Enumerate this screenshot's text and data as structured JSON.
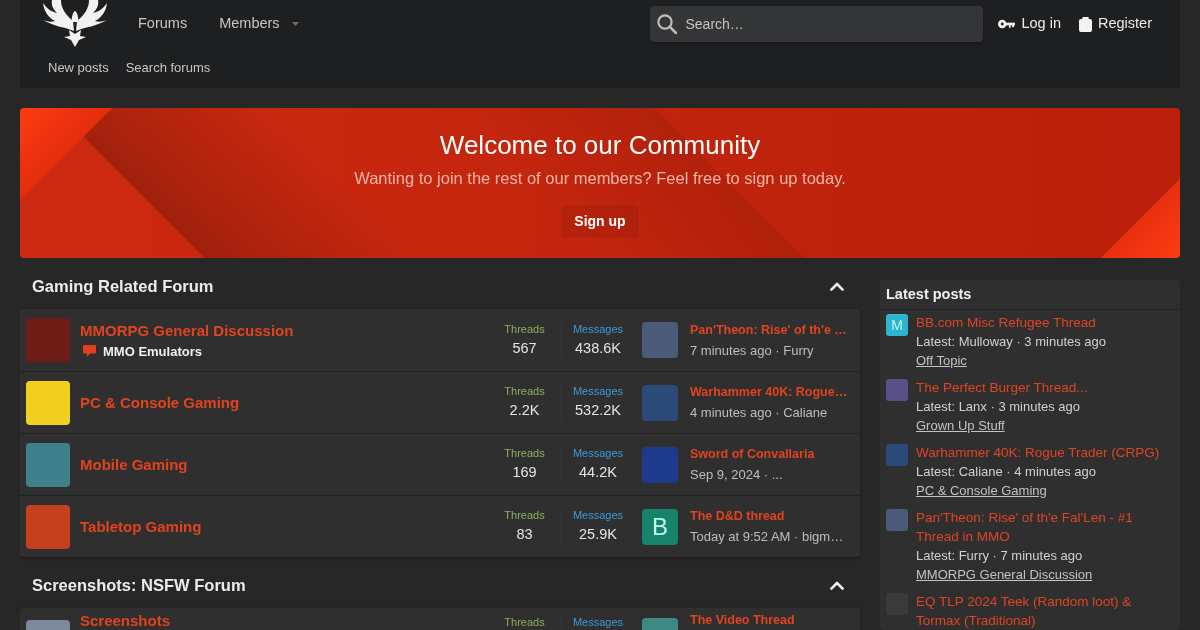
{
  "header": {
    "nav": [
      {
        "label": "Forums",
        "kind": "link"
      },
      {
        "label": "Members",
        "kind": "dropdown"
      }
    ],
    "search": {
      "placeholder": "Search…"
    },
    "account": [
      {
        "label": "Log in",
        "kind": "login"
      },
      {
        "label": "Register",
        "kind": "register"
      }
    ],
    "subnav": [
      "New posts",
      "Search forums"
    ]
  },
  "banner": {
    "title": "Welcome to our Community",
    "subtitle": "Wanting to join the rest of our members? Feel free to sign up today.",
    "button": "Sign up"
  },
  "categories": [
    {
      "title": "Gaming Related Forum",
      "expanded": true,
      "forums": [
        {
          "title": "MMORPG General Discussion",
          "icon": {
            "color": "#6e1d16"
          },
          "subforums": [
            "MMO Emulators"
          ],
          "stats": [
            {
              "kind": "threads",
              "label": "Threads",
              "value": "567"
            },
            {
              "kind": "messages",
              "label": "Messages",
              "value": "438.6K"
            }
          ],
          "last_post": {
            "title": "Pan'Theon: Rise' of th'e …",
            "meta": "7 minutes ago · Furry",
            "avatar": {
              "kind": "image",
              "color": "#4a5a78"
            }
          }
        },
        {
          "title": "PC & Console Gaming",
          "icon": {
            "color": "#f0cf1e"
          },
          "stats": [
            {
              "kind": "threads",
              "label": "Threads",
              "value": "2.2K"
            },
            {
              "kind": "messages",
              "label": "Messages",
              "value": "532.2K"
            }
          ],
          "last_post": {
            "title": "Warhammer 40K: Rogue…",
            "meta": "4 minutes ago · Caliane",
            "avatar": {
              "kind": "image",
              "color": "#2c4a78"
            }
          }
        },
        {
          "title": "Mobile Gaming",
          "icon": {
            "color": "#3f7f8c"
          },
          "stats": [
            {
              "kind": "threads",
              "label": "Threads",
              "value": "169"
            },
            {
              "kind": "messages",
              "label": "Messages",
              "value": "44.2K"
            }
          ],
          "last_post": {
            "title": "Sword of Convallaria",
            "meta": "Sep 9, 2024 · ...",
            "avatar": {
              "kind": "image",
              "color": "#1e3a8c"
            }
          }
        },
        {
          "title": "Tabletop Gaming",
          "icon": {
            "color": "#c4401c"
          },
          "stats": [
            {
              "kind": "threads",
              "label": "Threads",
              "value": "83"
            },
            {
              "kind": "messages",
              "label": "Messages",
              "value": "25.9K"
            }
          ],
          "last_post": {
            "title": "The D&D thread",
            "meta": "Today at 9:52 AM · bigm…",
            "avatar": {
              "kind": "letter",
              "letter": "B",
              "color": "#17836a"
            }
          }
        }
      ]
    },
    {
      "title": "Screenshots: NSFW Forum",
      "expanded": true,
      "forums": [
        {
          "title": "Screenshots",
          "icon": {
            "color": "#7d8a9c"
          },
          "stats": [
            {
              "kind": "threads",
              "label": "Threads"
            },
            {
              "kind": "messages",
              "label": "Messages"
            }
          ],
          "last_post": {
            "title": "The Video Thread",
            "avatar": {
              "kind": "image",
              "color": "#3c8a82"
            }
          }
        }
      ]
    }
  ],
  "sidebar": {
    "title": "Latest posts",
    "items": [
      {
        "title": "BB.com Misc Refugee Thread",
        "meta": "Latest: Mulloway · 3 minutes ago",
        "forum": "Off Topic",
        "avatar": {
          "kind": "letter",
          "letter": "M",
          "color": "#2bb5cf"
        }
      },
      {
        "title": "The Perfect Burger Thread...",
        "meta": "Latest: Lanx · 3 minutes ago",
        "forum": "Grown Up Stuff",
        "avatar": {
          "kind": "image",
          "color": "#5a5088"
        }
      },
      {
        "title": "Warhammer 40K: Rogue Trader (CRPG)",
        "meta": "Latest: Caliane · 4 minutes ago",
        "forum": "PC & Console Gaming",
        "avatar": {
          "kind": "image",
          "color": "#2c4a78"
        }
      },
      {
        "title": "Pan'Theon: Rise' of th'e Fal'Len - #1 Thread in MMO",
        "meta": "Latest: Furry · 7 minutes ago",
        "forum": "MMORPG General Discussion",
        "avatar": {
          "kind": "image",
          "color": "#4a5a78"
        }
      },
      {
        "title": "EQ TLP 2024 Teek (Random loot) & Tormax (Traditional)",
        "avatar": {
          "kind": "image",
          "color": "#3a3a3a"
        }
      }
    ]
  }
}
